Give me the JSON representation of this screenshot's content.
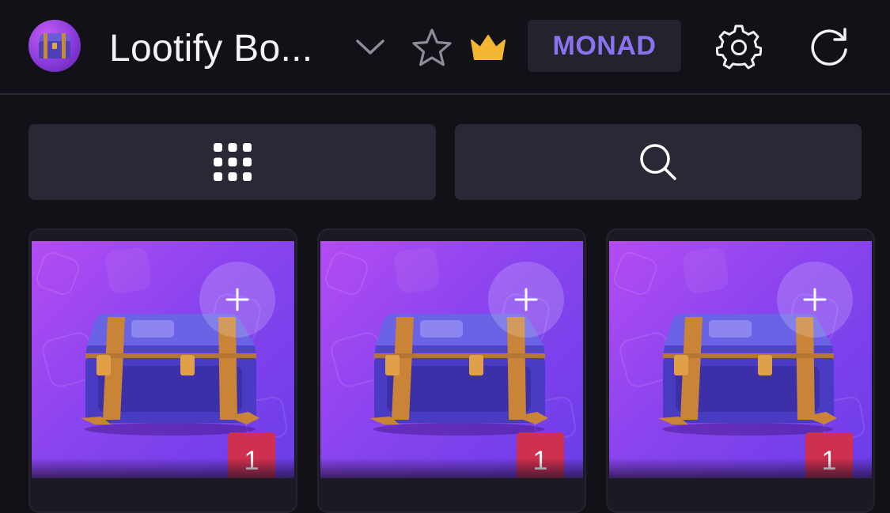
{
  "header": {
    "title": "Lootify Bo...",
    "network_label": "MONAD",
    "avatar_icon": "treasure-chest-icon",
    "icons": [
      "chevron-down-icon",
      "star-icon",
      "crown-icon",
      "gear-icon",
      "refresh-icon"
    ],
    "colors": {
      "network_text": "#8b72f0",
      "crown": "#f2b632",
      "badge": "#d0304f"
    }
  },
  "toolbar": {
    "grid_icon": "grid-icon",
    "search_icon": "search-icon"
  },
  "cards": [
    {
      "count": "1",
      "add_icon": "plus-icon"
    },
    {
      "count": "1",
      "add_icon": "plus-icon"
    },
    {
      "count": "1",
      "add_icon": "plus-icon"
    }
  ]
}
